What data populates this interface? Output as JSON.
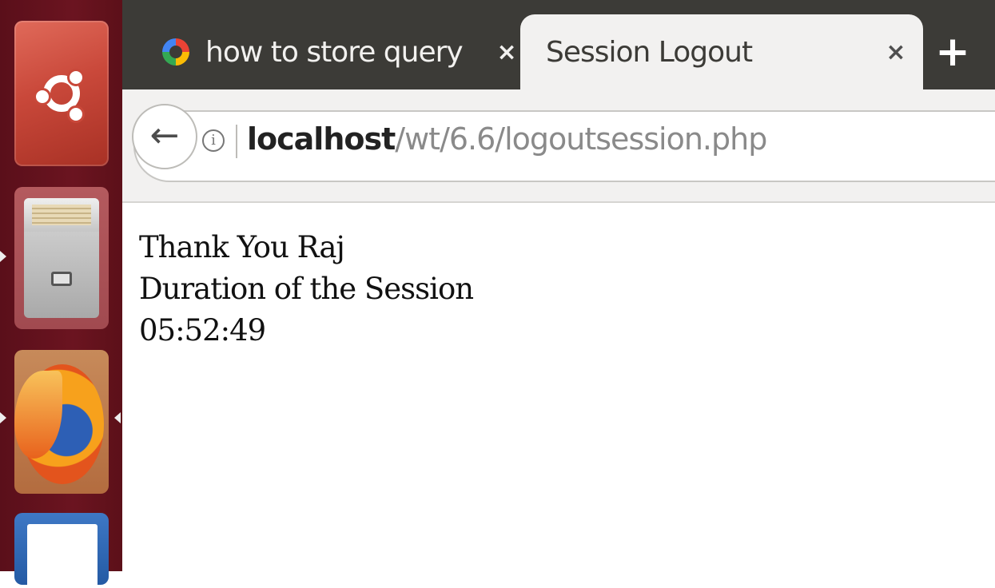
{
  "tabs": [
    {
      "label": "how to store query i...",
      "icon": "google-g-icon",
      "close": "×",
      "active": false
    },
    {
      "label": "Session Logout",
      "close": "×",
      "active": true
    }
  ],
  "new_tab": "+",
  "nav": {
    "back": "←",
    "info": "i",
    "url_host": "localhost",
    "url_path": "/wt/6.6/logoutsession.php"
  },
  "page": {
    "line1": "Thank You Raj",
    "line2": "Duration of the Session",
    "line3": "05:52:49"
  },
  "launcher": [
    "ubuntu-icon",
    "files-icon",
    "firefox-icon",
    "writer-icon"
  ]
}
